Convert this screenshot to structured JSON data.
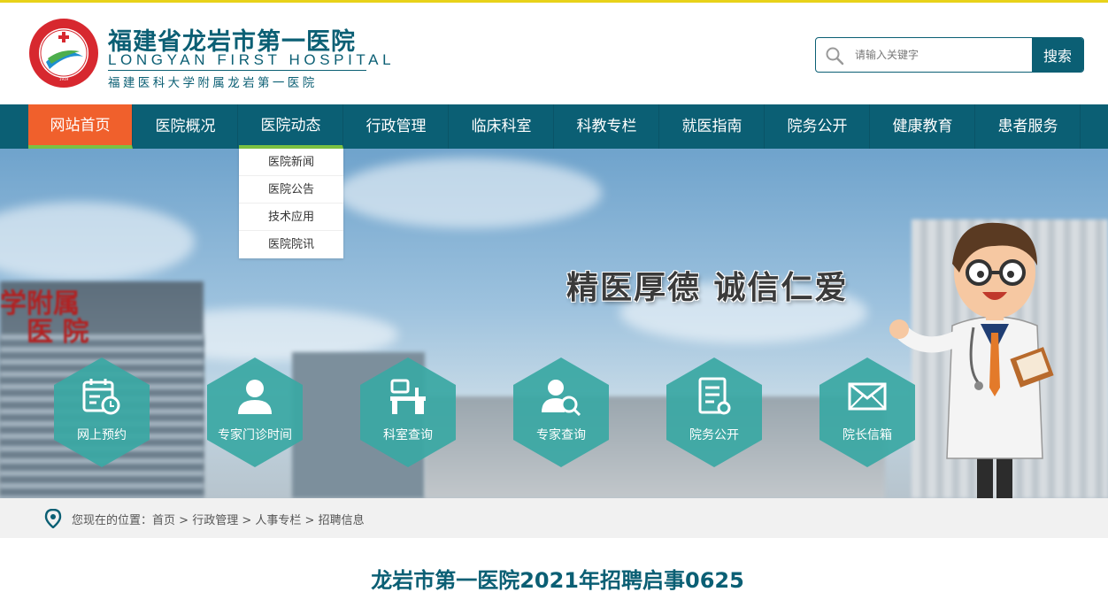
{
  "header": {
    "title_cn": "福建省龙岩市第一医院",
    "title_en": "LONGYAN FIRST HOSPITAL",
    "subtitle": "福建医科大学附属龙岩第一医院",
    "logo_icon": "hospital-seal-logo",
    "logo_ring_text": "福建省龙岩市第一医院",
    "logo_ring_en": "LONGYAN FIRST HOSPITAL",
    "logo_year": "1919"
  },
  "search": {
    "placeholder": "请输入关键字",
    "button_label": "搜索",
    "icon": "search-icon"
  },
  "nav": {
    "items": [
      {
        "label": "网站首页"
      },
      {
        "label": "医院概况"
      },
      {
        "label": "医院动态"
      },
      {
        "label": "行政管理"
      },
      {
        "label": "临床科室"
      },
      {
        "label": "科教专栏"
      },
      {
        "label": "就医指南"
      },
      {
        "label": "院务公开"
      },
      {
        "label": "健康教育"
      },
      {
        "label": "患者服务"
      }
    ],
    "dropdown": [
      "医院新闻",
      "医院公告",
      "技术应用",
      "医院院讯"
    ]
  },
  "banner": {
    "slogan": "精医厚德    诚信仁爱",
    "sign_line1": "学附属",
    "sign_line2": "医 院",
    "quick_links": [
      {
        "label": "网上预约",
        "icon": "calendar-clock-icon"
      },
      {
        "label": "专家门诊时间",
        "icon": "user-icon"
      },
      {
        "label": "科室查询",
        "icon": "desk-icon"
      },
      {
        "label": "专家查询",
        "icon": "user-search-icon"
      },
      {
        "label": "院务公开",
        "icon": "document-icon"
      },
      {
        "label": "院长信箱",
        "icon": "envelope-icon"
      }
    ]
  },
  "breadcrumb": {
    "prefix": "您现在的位置：",
    "items": [
      "首页",
      "行政管理",
      "人事专栏",
      "招聘信息"
    ],
    "separator": " > "
  },
  "article": {
    "title": "龙岩市第一医院2021年招聘启事0625"
  },
  "colors": {
    "brand": "#0b5f74",
    "active_nav": "#f0602c",
    "accent_green": "#7bc142",
    "hex_teal": "#3aa8a4",
    "top_line": "#e8d21a"
  }
}
